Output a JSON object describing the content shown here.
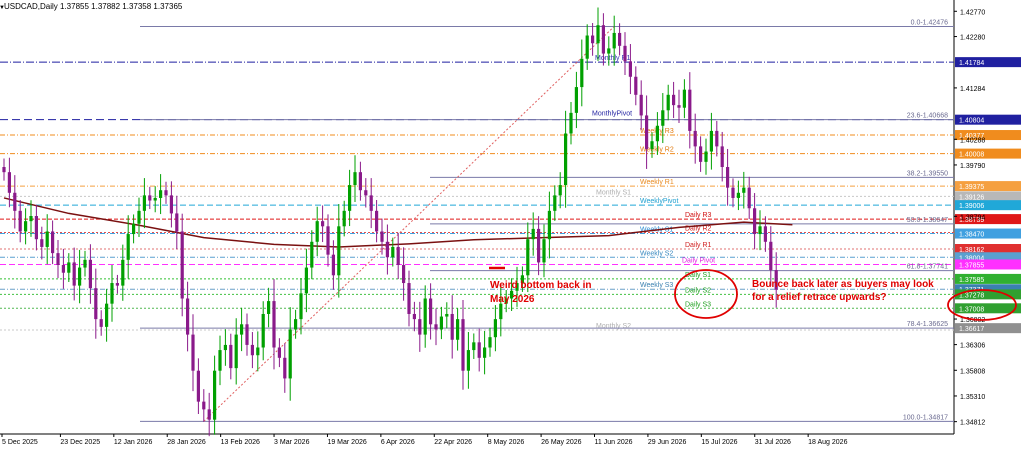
{
  "header": {
    "symbol_info": "USDCAD,Daily  1.37855 1.37882 1.37358 1.37365"
  },
  "chart_data": {
    "type": "candlestick",
    "ylim": [
      1.3465,
      1.4295
    ],
    "x_tick_labels": [
      "5 Dec 2025",
      "23 Dec 2025",
      "12 Jan 2026",
      "28 Jan 2026",
      "13 Feb 2026",
      "3 Mar 2026",
      "19 Mar 2026",
      "6 Apr 2026",
      "22 Apr 2026",
      "8 May 2026",
      "26 May 2026",
      "11 Jun 2026",
      "29 Jun 2026",
      "15 Jul 2026",
      "31 Jul 2026",
      "18 Aug 2026"
    ],
    "y_tick_labels": [
      "1.42770",
      "1.42280",
      "1.41284",
      "1.40288",
      "1.39790",
      "1.38794",
      "1.36802",
      "1.36306",
      "1.35808",
      "1.35310",
      "1.34812"
    ],
    "closes": [
      1.3965,
      1.3925,
      1.389,
      1.385,
      1.387,
      1.388,
      1.3835,
      1.382,
      1.385,
      1.3808,
      1.3785,
      1.377,
      1.379,
      1.3745,
      1.378,
      1.3795,
      1.374,
      1.368,
      1.3665,
      1.371,
      1.375,
      1.3745,
      1.3795,
      1.3845,
      1.3865,
      1.389,
      1.392,
      1.391,
      1.3915,
      1.393,
      1.392,
      1.3885,
      1.385,
      1.372,
      1.365,
      1.358,
      1.352,
      1.3505,
      1.3485,
      1.358,
      1.362,
      1.363,
      1.3585,
      1.365,
      1.367,
      1.363,
      1.361,
      1.3625,
      1.369,
      1.3715,
      1.3625,
      1.3605,
      1.3565,
      1.366,
      1.368,
      1.373,
      1.378,
      1.383,
      1.387,
      1.386,
      1.3805,
      1.3765,
      1.386,
      1.389,
      1.394,
      1.3965,
      1.393,
      1.392,
      1.389,
      1.385,
      1.383,
      1.38,
      1.382,
      1.3785,
      1.375,
      1.369,
      1.368,
      1.365,
      1.372,
      1.367,
      1.366,
      1.3685,
      1.369,
      1.364,
      1.368,
      1.358,
      1.362,
      1.3635,
      1.3605,
      1.3625,
      1.3645,
      1.368,
      1.371,
      1.372,
      1.3735,
      1.375,
      1.3765,
      1.3835,
      1.3855,
      1.379,
      1.3835,
      1.389,
      1.392,
      1.394,
      1.404,
      1.408,
      1.413,
      1.4185,
      1.423,
      1.4215,
      1.425,
      1.4195,
      1.4205,
      1.4235,
      1.421,
      1.418,
      1.415,
      1.4115,
      1.4075,
      1.401,
      1.4025,
      1.4055,
      1.4085,
      1.4115,
      1.4095,
      1.409,
      1.4125,
      1.4045,
      1.4015,
      1.3985,
      1.4005,
      1.4045,
      1.4015,
      1.3975,
      1.3935,
      1.3915,
      1.3925,
      1.3935,
      1.3895,
      1.3845,
      1.386,
      1.383,
      1.3775,
      1.3737
    ],
    "moving_average": [
      [
        0,
        1.3915
      ],
      [
        12,
        1.3885
      ],
      [
        25,
        1.3862
      ],
      [
        37,
        1.3838
      ],
      [
        50,
        1.3825
      ],
      [
        62,
        1.382
      ],
      [
        75,
        1.3826
      ],
      [
        87,
        1.3834
      ],
      [
        100,
        1.3838
      ],
      [
        112,
        1.3842
      ],
      [
        125,
        1.3858
      ],
      [
        137,
        1.3868
      ],
      [
        146,
        1.3863
      ]
    ],
    "horizontal_levels": [
      {
        "name": "Fib 0.0",
        "label": "0.0-1.42476",
        "value": 1.42476
      },
      {
        "name": "Monthly R1",
        "label": "Monthly R1",
        "value": 1.41784,
        "axis_label": "1.41784"
      },
      {
        "name": "Fib 23.6",
        "label": "23.6-1.40668",
        "value": 1.40668,
        "axis_label": "1.40804"
      },
      {
        "name": "MonthlyPivot",
        "label": "MonthlyPivot",
        "value": 1.40668
      },
      {
        "name": "Weekly R3",
        "label": "Weekly R3",
        "value": 1.4037,
        "axis_label": "1.40377"
      },
      {
        "name": "Weekly R2",
        "label": "Weekly R2",
        "value": 1.4001,
        "axis_label": "1.40008"
      },
      {
        "name": "Fib 38.2",
        "label": "38.2-1.39550",
        "value": 1.3955
      },
      {
        "name": "Weekly R1",
        "label": "Weekly R1",
        "value": 1.3938,
        "axis_label": "1.39375"
      },
      {
        "name": "Monthly S1",
        "label": "Monthly S1",
        "value": 1.3918,
        "axis_label": "1.39126"
      },
      {
        "name": "WeeklyPivot",
        "label": "WeeklyPivot",
        "value": 1.3901,
        "axis_label": "1.39006"
      },
      {
        "name": "Fib 50.0",
        "label": "50.0-1.38647",
        "value": 1.38647
      },
      {
        "name": "Daily R3",
        "label": "Daily R3",
        "value": 1.3874,
        "axis_label": "1.38739"
      },
      {
        "name": "Weekly S1",
        "label": "Weekly S1",
        "value": 1.3846,
        "axis_label": "1.38470"
      },
      {
        "name": "Daily R2",
        "label": "Daily R2",
        "value": 1.3848
      },
      {
        "name": "Daily R1",
        "label": "Daily R1",
        "value": 1.3816,
        "axis_label": "1.38162"
      },
      {
        "name": "Weekly S2",
        "label": "Weekly S2",
        "value": 1.38,
        "axis_label": "1.38004"
      },
      {
        "name": "Fib 61.8",
        "label": "61.8-1.37741",
        "value": 1.37741
      },
      {
        "name": "Daily Pivot",
        "label": "Daily Pivot",
        "value": 1.3786,
        "axis_label": "1.37855"
      },
      {
        "name": "Daily S1",
        "label": "Daily S1",
        "value": 1.3758,
        "axis_label": "1.37585"
      },
      {
        "name": "Weekly S3",
        "label": "Weekly S3",
        "value": 1.3738,
        "axis_label": "1.37371"
      },
      {
        "name": "Daily S2",
        "label": "Daily S2",
        "value": 1.3728,
        "axis_label": "1.37278"
      },
      {
        "name": "Daily S3",
        "label": "Daily S3",
        "value": 1.3701,
        "axis_label": "1.37008"
      },
      {
        "name": "Monthly S2",
        "label": "Monthly S2",
        "value": 1.3659
      },
      {
        "name": "Fib 78.6",
        "label": "78.4-1.36625",
        "value": 1.36625,
        "axis_label": "1.36617"
      },
      {
        "name": "Fib 100.0",
        "label": "100.0-1.34817",
        "value": 1.34817
      }
    ],
    "annotations": [
      {
        "name": "weird-bottom",
        "text": "Weird bottom back in May 2026"
      },
      {
        "name": "bounce-back",
        "text": "Bounce back later as buyers may look for a relief retrace upwards?"
      }
    ]
  }
}
